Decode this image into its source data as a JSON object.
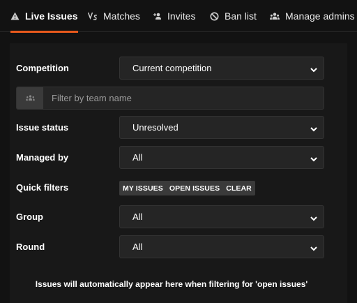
{
  "tabs": [
    {
      "label": "Live Issues",
      "icon": "warning-icon",
      "active": true
    },
    {
      "label": "Matches",
      "icon": "versus-icon",
      "active": false
    },
    {
      "label": "Invites",
      "icon": "user-plus-icon",
      "active": false
    },
    {
      "label": "Ban list",
      "icon": "ban-icon",
      "active": false
    },
    {
      "label": "Manage admins",
      "icon": "users-icon",
      "active": false
    }
  ],
  "filters": {
    "competition": {
      "label": "Competition",
      "value": "Current competition"
    },
    "team_filter": {
      "placeholder": "Filter by team name",
      "value": ""
    },
    "issue_status": {
      "label": "Issue status",
      "value": "Unresolved"
    },
    "managed_by": {
      "label": "Managed by",
      "value": "All"
    },
    "quick_filters": {
      "label": "Quick filters",
      "buttons": [
        "MY ISSUES",
        "OPEN ISSUES",
        "CLEAR"
      ]
    },
    "group": {
      "label": "Group",
      "value": "All"
    },
    "round": {
      "label": "Round",
      "value": "All"
    }
  },
  "message": "Issues will automatically appear here when filtering for 'open issues'",
  "colors": {
    "accent": "#e8591c",
    "background": "#121212",
    "panel": "#181818",
    "input": "#252525"
  }
}
